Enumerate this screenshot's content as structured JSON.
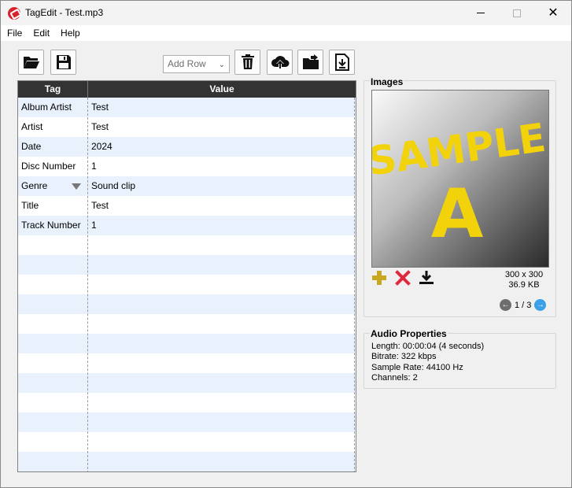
{
  "window": {
    "title": "TagEdit  -  Test.mp3",
    "close_glyph": "✕"
  },
  "menu": {
    "items": [
      "File",
      "Edit",
      "Help"
    ]
  },
  "toolbar": {
    "add_row_label": "Add Row",
    "icons": [
      "open-folder-icon",
      "save-icon",
      "trash-icon",
      "cloud-upload-icon",
      "folder-export-icon",
      "file-download-icon"
    ]
  },
  "table": {
    "headers": {
      "tag": "Tag",
      "value": "Value"
    },
    "rows": [
      {
        "tag": "Album Artist",
        "value": "Test"
      },
      {
        "tag": "Artist",
        "value": "Test"
      },
      {
        "tag": "Date",
        "value": "2024"
      },
      {
        "tag": "Disc Number",
        "value": "1"
      },
      {
        "tag": "Genre",
        "value": "Sound clip"
      },
      {
        "tag": "Title",
        "value": "Test"
      },
      {
        "tag": "Track Number",
        "value": "1"
      }
    ],
    "empty_rows": 12
  },
  "images": {
    "title": "Images",
    "sample_text_line1": "SAMPLE",
    "sample_text_line2": "A",
    "dimensions": "300 x 300",
    "size": "36.9 KB",
    "page_indicator": "1 / 3"
  },
  "audio": {
    "title": "Audio Properties",
    "length": "Length: 00:00:04 (4 seconds)",
    "bitrate": "Bitrate: 322 kbps",
    "sample_rate": "Sample Rate: 44100 Hz",
    "channels": "Channels: 2"
  },
  "colors": {
    "header_bg": "#333333",
    "row_alt": "#e8f1fc",
    "sample_text": "#f2d20a",
    "add_icon": "#c8a820",
    "remove_icon": "#e0283c",
    "nav_next": "#3aa0e8"
  }
}
